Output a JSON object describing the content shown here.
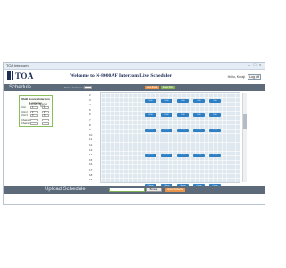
{
  "window": {
    "title": "TOA Intercom"
  },
  "header": {
    "logo_text": "TOA",
    "title": "Welcome to N-8000AF Intercom Live Scheduler",
    "greeting": "Hello, Kuraji",
    "logout_label": "Log off"
  },
  "schedule_bar": {
    "title": "Schedule",
    "select_label": "Select Instrument",
    "button_1": "Save Event",
    "button_2": "Reset Filter"
  },
  "panel": {
    "title": "Multi Source Intercom Launcher",
    "col_1": "Interval Unit",
    "col_2": "Interval Nmb",
    "rows": [
      {
        "label": "Unit",
        "v1": "1",
        "v2": "1"
      },
      {
        "label": "Unit 2",
        "v1": "2",
        "v2": "2"
      },
      {
        "label": "Unit 3",
        "v1": "3",
        "v2": "3"
      },
      {
        "label": "Channel 1",
        "v1": "",
        "v2": ""
      },
      {
        "label": "Channel 2",
        "v1": "",
        "v2": ""
      }
    ]
  },
  "hours": [
    "2",
    "3",
    "4",
    "5",
    "6",
    "7",
    "8",
    "9",
    "10",
    "11",
    "12",
    "13",
    "14",
    "15",
    "16",
    "17",
    "18",
    "19"
  ],
  "slots": [
    {
      "row": 1,
      "col": 0,
      "label": "5:00"
    },
    {
      "row": 1,
      "col": 1,
      "label": "5:00"
    },
    {
      "row": 1,
      "col": 2,
      "label": "5:00"
    },
    {
      "row": 1,
      "col": 3,
      "label": "5:00"
    },
    {
      "row": 1,
      "col": 4,
      "label": "5:00"
    },
    {
      "row": 4,
      "col": 0,
      "label": "8:00"
    },
    {
      "row": 4,
      "col": 1,
      "label": "8:00"
    },
    {
      "row": 4,
      "col": 2,
      "label": "8:00"
    },
    {
      "row": 4,
      "col": 3,
      "label": "8:00"
    },
    {
      "row": 4,
      "col": 4,
      "label": "8:00"
    },
    {
      "row": 7,
      "col": 0,
      "label": "10:00"
    },
    {
      "row": 7,
      "col": 1,
      "label": "10:00"
    },
    {
      "row": 7,
      "col": 2,
      "label": "10:00"
    },
    {
      "row": 7,
      "col": 3,
      "label": "10:00"
    },
    {
      "row": 7,
      "col": 4,
      "label": "10:00"
    },
    {
      "row": 12,
      "col": 0,
      "label": "14:00"
    },
    {
      "row": 12,
      "col": 1,
      "label": "14:00"
    },
    {
      "row": 12,
      "col": 2,
      "label": "14:00"
    },
    {
      "row": 12,
      "col": 3,
      "label": "14:00"
    },
    {
      "row": 12,
      "col": 4,
      "label": "14:00"
    },
    {
      "row": 18,
      "col": 0,
      "label": "Chime"
    },
    {
      "row": 18,
      "col": 1,
      "label": "Chime"
    },
    {
      "row": 18,
      "col": 2,
      "label": "Chime"
    },
    {
      "row": 18,
      "col": 3,
      "label": "Chime"
    },
    {
      "row": 18,
      "col": 4,
      "label": "Chime"
    }
  ],
  "upload_bar": {
    "title": "Upload Schedule",
    "browse_label": "Browse",
    "upload_label": "Upload Schedule"
  },
  "colors": {
    "accent": "#2e7fc4",
    "bar": "#5c6a7a",
    "orange": "#e8944a",
    "green": "#8ab45a"
  }
}
